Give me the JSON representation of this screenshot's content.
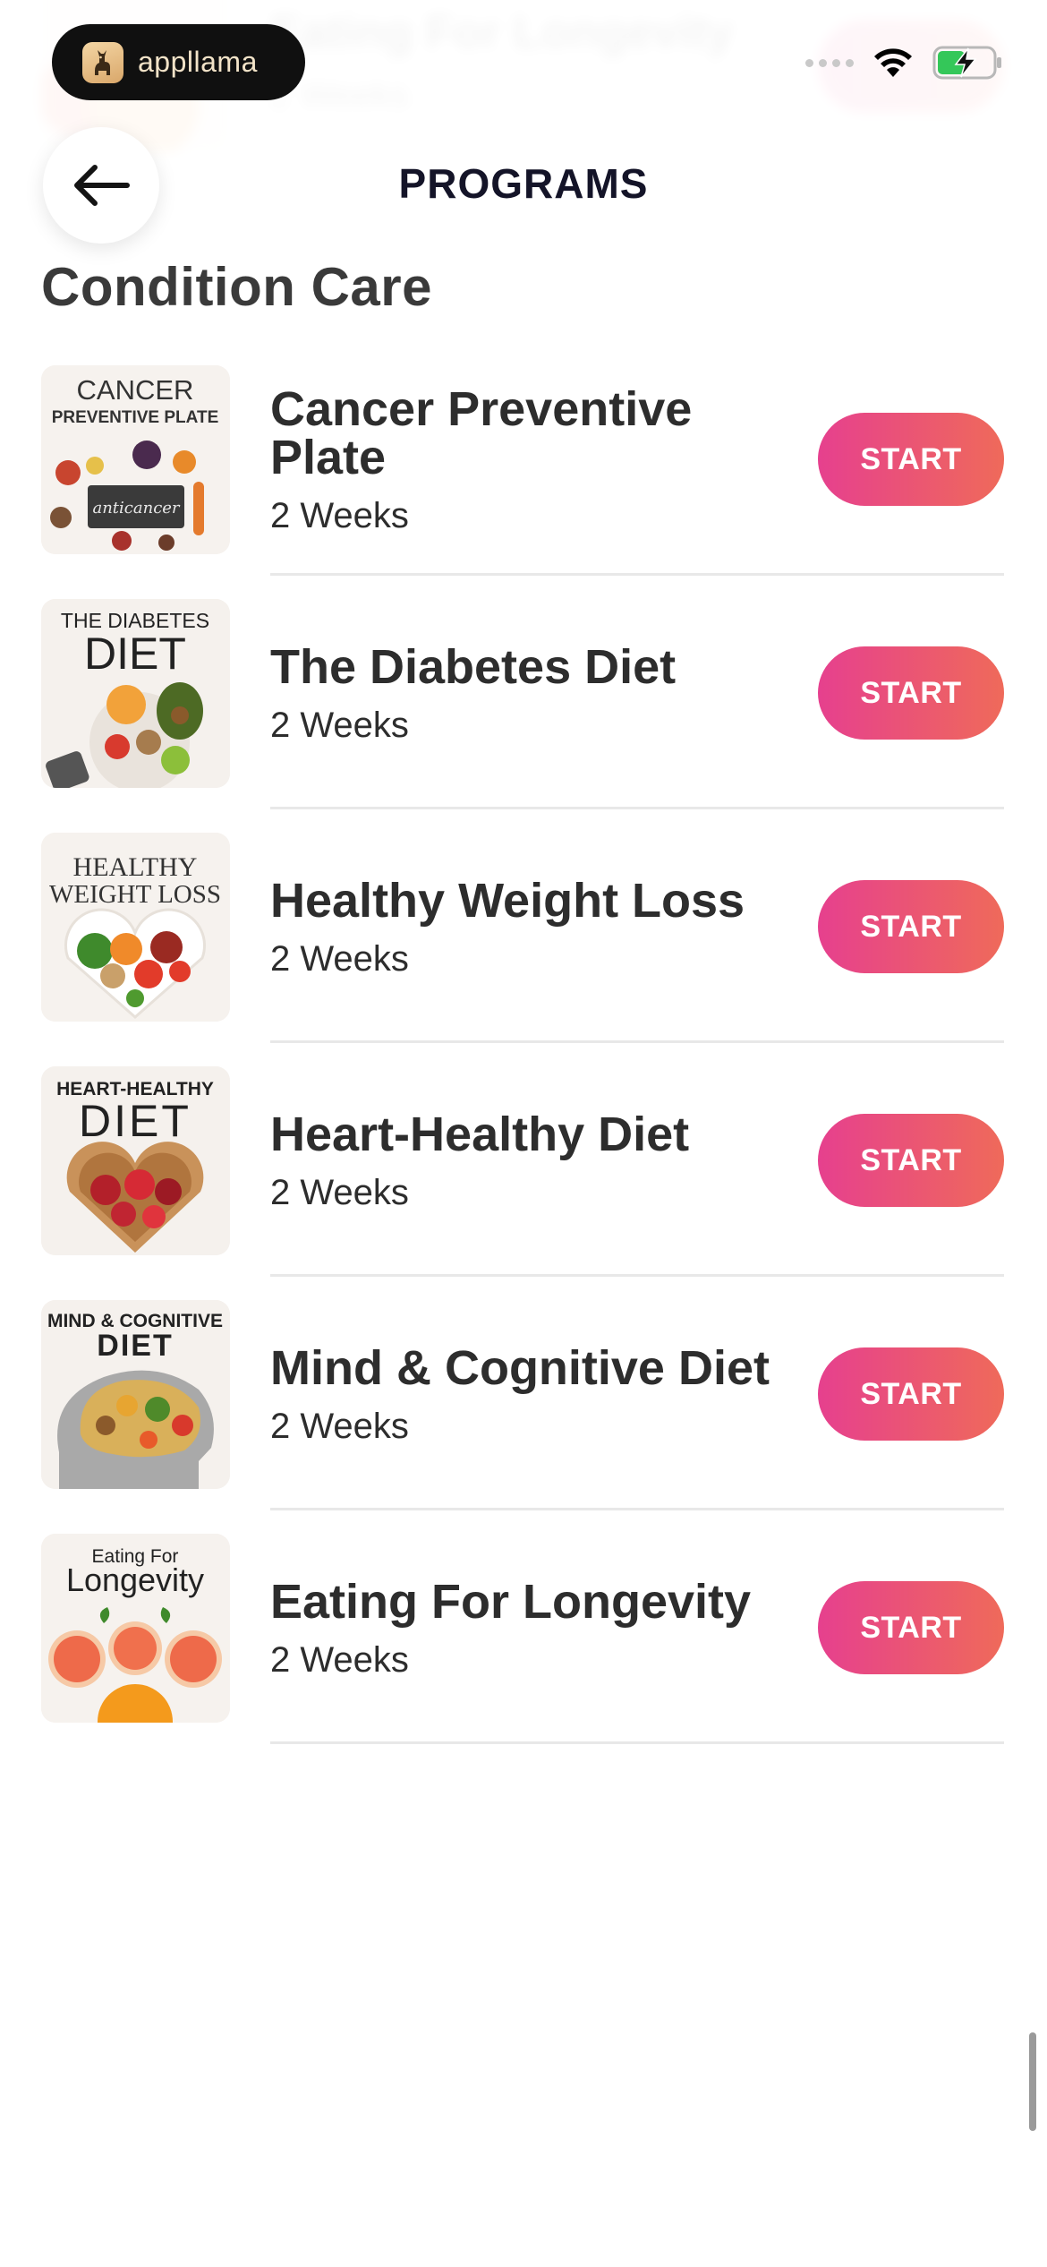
{
  "app": {
    "brand_name": "appllama",
    "page_title": "PROGRAMS",
    "section_title": "Condition Care"
  },
  "ghost_row": {
    "title": "Eating For Longevity",
    "duration": "2 Weeks"
  },
  "programs": [
    {
      "title": "Cancer Preventive Plate",
      "duration": "2 Weeks",
      "button": "START",
      "thumb_lines": [
        "CANCER",
        "PREVENTIVE PLATE",
        "anticancer"
      ]
    },
    {
      "title": "The Diabetes Diet",
      "duration": "2 Weeks",
      "button": "START",
      "thumb_lines": [
        "THE DIABETES",
        "DIET"
      ]
    },
    {
      "title": "Healthy Weight Loss",
      "duration": "2 Weeks",
      "button": "START",
      "thumb_lines": [
        "HEALTHY",
        "WEIGHT LOSS"
      ]
    },
    {
      "title": "Heart-Healthy Diet",
      "duration": "2 Weeks",
      "button": "START",
      "thumb_lines": [
        "HEART-HEALTHY",
        "DIET"
      ]
    },
    {
      "title": "Mind & Cognitive Diet",
      "duration": "2 Weeks",
      "button": "START",
      "thumb_lines": [
        "MIND & COGNITIVE",
        "DIET"
      ]
    },
    {
      "title": "Eating For Longevity",
      "duration": "2 Weeks",
      "button": "START",
      "thumb_lines": [
        "Eating For",
        "Longevity"
      ]
    }
  ],
  "colors": {
    "accent_start": "#e6408e",
    "accent_end": "#ef6a5a",
    "battery_fill": "#34c759"
  },
  "icons": {
    "back": "arrow-left-icon",
    "wifi": "wifi-icon",
    "battery": "battery-charging-icon",
    "brand": "llama-logo-icon"
  }
}
